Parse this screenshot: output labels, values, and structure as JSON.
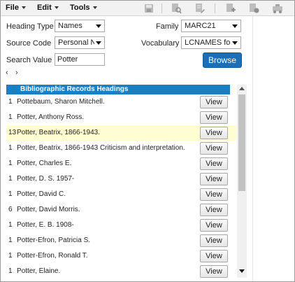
{
  "menu": {
    "file": "File",
    "edit": "Edit",
    "tools": "Tools"
  },
  "toolbar_icons": [
    "save-icon",
    "search-record-icon",
    "edit-record-icon",
    "add-record-icon",
    "record-action-icon",
    "batch-icon"
  ],
  "form": {
    "heading_type_label": "Heading Type",
    "heading_type_value": "Names",
    "family_label": "Family",
    "family_value": "MARC21",
    "source_code_label": "Source Code",
    "source_code_value": "Personal N",
    "vocabulary_label": "Vocabulary",
    "vocabulary_value": "LCNAMES fo",
    "search_value_label": "Search Value",
    "search_value": "Potter",
    "browse_label": "Browse"
  },
  "nav": {
    "prev": "‹",
    "next": "›"
  },
  "results": {
    "header": "Bibliographic Records Headings",
    "view_label": "View",
    "rows": [
      {
        "count": "1",
        "heading": "Pottebaum, Sharon Mitchell."
      },
      {
        "count": "1",
        "heading": "Potter, Anthony Ross."
      },
      {
        "count": "13",
        "heading": "Potter, Beatrix, 1866-1943.",
        "highlight": true
      },
      {
        "count": "1",
        "heading": "Potter, Beatrix, 1866-1943 Criticism and interpretation."
      },
      {
        "count": "1",
        "heading": "Potter, Charles E."
      },
      {
        "count": "1",
        "heading": "Potter, D. S. 1957-"
      },
      {
        "count": "1",
        "heading": "Potter, David C."
      },
      {
        "count": "6",
        "heading": "Potter, David Morris."
      },
      {
        "count": "1",
        "heading": "Potter, E. B. 1908-"
      },
      {
        "count": "1",
        "heading": "Potter-Efron, Patricia S."
      },
      {
        "count": "1",
        "heading": "Potter-Efron, Ronald T."
      },
      {
        "count": "1",
        "heading": "Potter, Elaine."
      }
    ]
  },
  "colors": {
    "accent": "#1b7fc1",
    "button": "#1b6fb6",
    "highlight_row": "#fffed0"
  }
}
